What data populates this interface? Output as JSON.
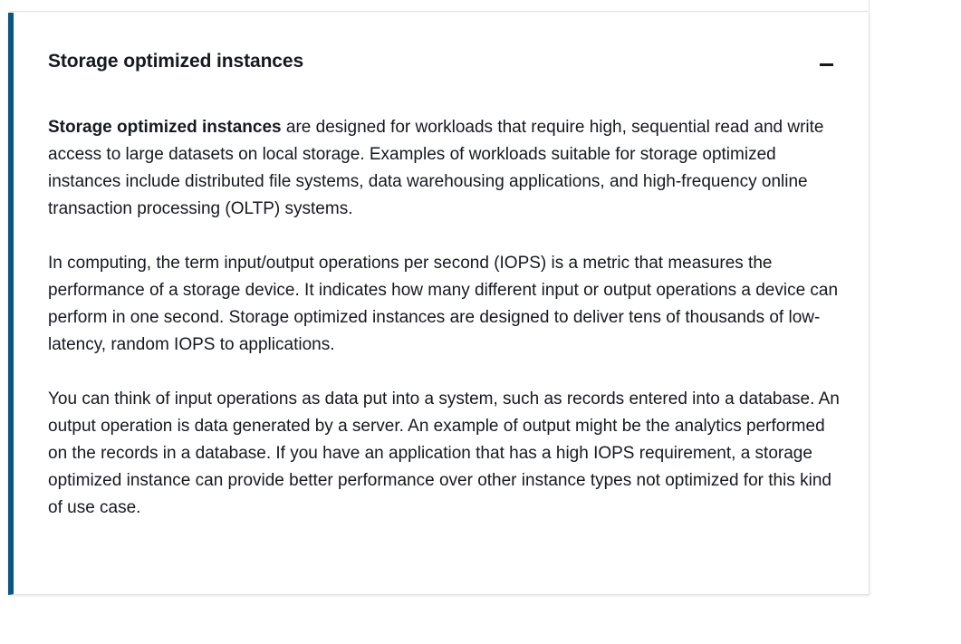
{
  "section": {
    "title": "Storage optimized instances",
    "collapse_icon": "minus-icon",
    "accent_color": "#0b5681",
    "paragraphs": {
      "p1": {
        "lead": "Storage optimized instances",
        "text": " are designed for workloads that require high, sequential read and write access to large datasets on local storage. Examples of workloads suitable for storage optimized instances include distributed file systems, data warehousing applications, and high-frequency online transaction processing (OLTP) systems."
      },
      "p2": {
        "text": "In computing, the term input/output operations per second (IOPS) is a metric that measures the performance of a storage device. It indicates how many different input or output operations a device can perform in one second. Storage optimized instances are designed to deliver tens of thousands of low-latency, random IOPS to applications."
      },
      "p3": {
        "text": "You can think of input operations as data put into a system, such as records entered into a database. An output operation is data generated by a server. An example of output might be the analytics performed on the records in a database. If you have an application that has a high IOPS requirement, a storage optimized instance can provide better performance over other instance types not optimized for this kind of use case."
      }
    }
  }
}
